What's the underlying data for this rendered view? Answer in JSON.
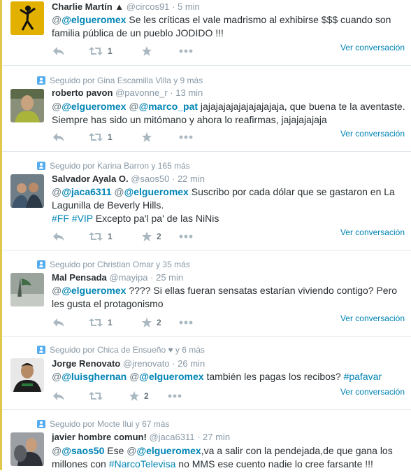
{
  "stream": {
    "tweets": [
      {
        "context": "",
        "name": "Charlie Martín ▲",
        "handle": "@circos91",
        "dot": "·",
        "time": "5 min",
        "line1_mention": "@elgueromex",
        "line1_rest": " Se les críticas el vale madrismo  al exhibirse $$$ cuando son",
        "line2": "familia pública de un pueblo JODIDO !!!",
        "retweets": "1",
        "favorites": "",
        "view": "Ver conversación"
      },
      {
        "context": "Seguido por Gina Escamilla Villa y 9 más",
        "name": "roberto pavon",
        "handle": "@pavonne_r",
        "dot": "·",
        "time": "13 min",
        "line1_mention1": "@elgueromex",
        "line1_mention2": "@marco_pat",
        "line1_rest": " jajajajajajajajajajaja, que buena te la aventaste.",
        "line2": "Siempre has sido un mitómano y ahora lo reafirmas, jajajajajaja",
        "retweets": "1",
        "favorites": "",
        "view": "Ver conversación"
      },
      {
        "context": "Seguido por Karina Barron y 165 más",
        "name": "Salvador Ayala O.",
        "handle": "@saos50",
        "dot": "·",
        "time": "22 min",
        "line1_mention1": "@jaca6311",
        "line1_mention2": "@elgueromex",
        "line1_rest": " Suscribo por cada dólar que se gastaron en La",
        "line2": "Lagunilla de Beverly Hills.",
        "line3_tag1": "#FF",
        "line3_tag2": "#VIP",
        "line3_rest": " Excepto pa'l pa' de las NiNis",
        "retweets": "1",
        "favorites": "2",
        "view": "Ver conversación"
      },
      {
        "context": "Seguido por Christian Omar y 35 más",
        "name": "Mal Pensada",
        "handle": "@mayipa",
        "dot": "·",
        "time": "25 min",
        "line1_mention": "@elgueromex",
        "line1_rest": " ???? Si ellas fueran sensatas estarían viviendo contigo? Pero",
        "line2": "les gusta el protagonismo",
        "retweets": "1",
        "favorites": "2",
        "view": "Ver conversación"
      },
      {
        "context": "Seguido por Chica de Ensueño ♥ y 6 más",
        "name": "Jorge Renovato",
        "handle": "@jrenovato",
        "dot": "·",
        "time": "26 min",
        "line1_mention1": "@luisghernan",
        "line1_mention2": "@elgueromex",
        "line1_rest": " también les pagas los recibos?  ",
        "line1_tag": "#pafavar",
        "retweets": "",
        "favorites": "2",
        "view": "Ver conversación"
      },
      {
        "context": "Seguido por Mocte Ilui y 67 más",
        "name": "javier hombre comun!",
        "handle": "@jaca6311",
        "dot": "·",
        "time": "27 min",
        "line1_mention1": "@saos50",
        "line1_mid": " Ese ",
        "line1_mention2": "@elgueromex",
        "line1_rest": ",va a salir con la pendejada,de que gana los",
        "line2_pre": "millones con ",
        "line2_tag": "#NarcoTelevisa",
        "line2_rest": " no MMS ese cuento nadie lo cree farsante !!!"
      }
    ]
  },
  "icons": {
    "reply": "reply-icon",
    "retweet": "retweet-icon",
    "favorite": "star-icon",
    "more": "more-icon",
    "promoted": "person-icon"
  },
  "colors": {
    "link": "#0084b4",
    "icon": "#aab8c2",
    "meta": "#8899a6"
  }
}
